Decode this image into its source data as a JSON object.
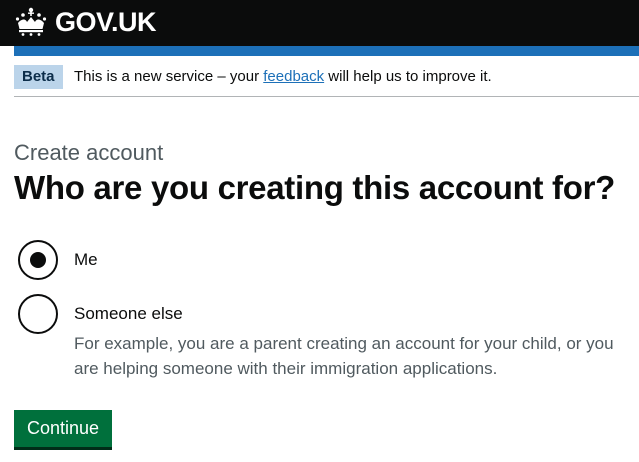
{
  "header": {
    "logo_text": "GOV.UK",
    "logo_icon": "crown-icon",
    "background_color": "#0b0c0c",
    "stripe_color": "#1d70b8"
  },
  "phase_banner": {
    "tag": "Beta",
    "text_before": "This is a new service – your ",
    "link_text": "feedback",
    "text_after": " will help us to improve it."
  },
  "main": {
    "caption": "Create account",
    "heading": "Who are you creating this account for?",
    "radios": [
      {
        "label": "Me",
        "selected": true,
        "hint": ""
      },
      {
        "label": "Someone else",
        "selected": false,
        "hint": "For example, you are a parent creating an account for your child, or you are helping someone with their immigration applications."
      }
    ],
    "continue_label": "Continue",
    "button_color": "#00703c"
  }
}
